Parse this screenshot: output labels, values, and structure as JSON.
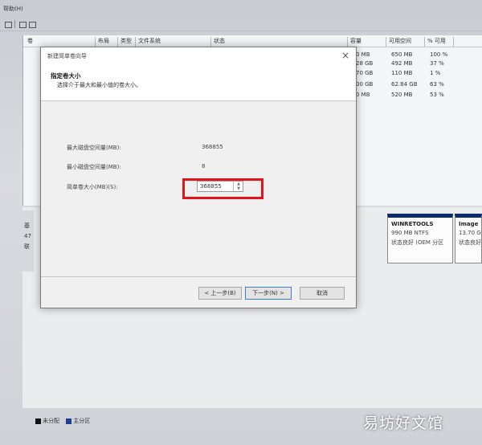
{
  "menubar": {
    "help": "帮助(H)"
  },
  "volume_list": {
    "headers": [
      "卷",
      "布局",
      "类型",
      "文件系统",
      "状态",
      "容量",
      "可用空间",
      "% 可用"
    ],
    "rows": [
      {
        "capacity": "0 MB",
        "free": "650 MB",
        "pct": "100 %"
      },
      {
        "capacity": "28 GB",
        "free": "492 MB",
        "pct": "37 %"
      },
      {
        "capacity": "70 GB",
        "free": "110 MB",
        "pct": "1 %"
      },
      {
        "capacity": "00 GB",
        "free": "62.84 GB",
        "pct": "63 %"
      },
      {
        "capacity": "0 MB",
        "free": "520 MB",
        "pct": "53 %"
      }
    ]
  },
  "disk_map": {
    "label_lines": [
      "基",
      "47",
      "联"
    ],
    "partitions": [
      {
        "name": "WINRETOOLS",
        "size": "990 MB NTFS",
        "status": "状态良好 (OEM 分区"
      },
      {
        "name": "Image",
        "size": "13.70 G",
        "status": "状态良好"
      }
    ],
    "legend": [
      {
        "label": "未分配",
        "color": "#111111"
      },
      {
        "label": "主分区",
        "color": "#1f3f96"
      }
    ]
  },
  "dialog": {
    "title": "新建简单卷向导",
    "close_glyph": "×",
    "header_title": "指定卷大小",
    "header_subtitle": "选择介于最大和最小值的卷大小。",
    "max_label": "最大磁盘空间量(MB):",
    "max_value": "368855",
    "min_label": "最小磁盘空间量(MB):",
    "min_value": "8",
    "size_label": "简单卷大小(MB)(S):",
    "size_value": "368855",
    "back_button": "< 上一步(B)",
    "next_button": "下一步(N) >",
    "cancel_button": "取消"
  },
  "highlight_color": "#e0141a",
  "watermark": "易坊好文馆"
}
